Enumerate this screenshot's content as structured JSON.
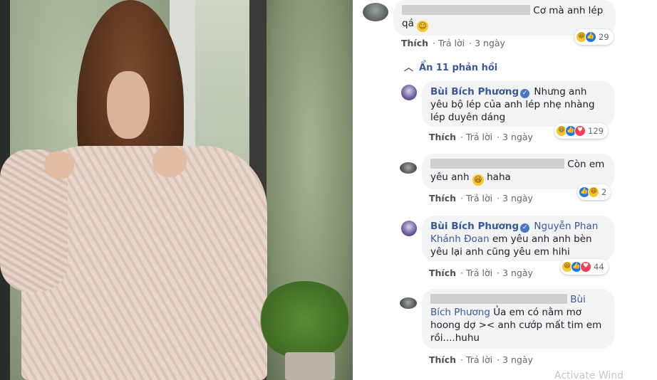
{
  "photo": {
    "alt": "woman in knit sweater by window"
  },
  "comments": [
    {
      "id": "c1",
      "redacted_name": true,
      "text": "Cơ mà anh lép qá",
      "emoji": "☺",
      "actions": {
        "like": "Thích",
        "reply": "Trả lời",
        "time": "3 ngày"
      },
      "reactions": [
        "haha",
        "like"
      ],
      "reaction_count": "29"
    }
  ],
  "toggle": {
    "label": "Ẩn 11 phản hồi"
  },
  "replies": [
    {
      "id": "r1",
      "name": "Bùi Bích Phương",
      "verified": true,
      "text": "Nhưng anh yêu bộ lép của anh lép nhẹ nhàng lép duyên dáng",
      "actions": {
        "like": "Thích",
        "reply": "Trả lời",
        "time": "3 ngày"
      },
      "reactions": [
        "haha",
        "like",
        "love"
      ],
      "reaction_count": "129"
    },
    {
      "id": "r2",
      "redacted_name": true,
      "text": "Còn em yêu anh",
      "text_after": "haha",
      "actions": {
        "like": "Thích",
        "reply": "Trả lời",
        "time": "3 ngày"
      },
      "reactions": [
        "like",
        "haha"
      ],
      "reaction_count": "2"
    },
    {
      "id": "r3",
      "name": "Bùi Bích Phương",
      "verified": true,
      "mention": "Nguyễn Phan Khánh Đoan",
      "text": "em yêu anh anh bèn yêu lại anh cũng yêu em hihi",
      "actions": {
        "like": "Thích",
        "reply": "Trả lời",
        "time": "3 ngày"
      },
      "reactions": [
        "haha",
        "like",
        "love"
      ],
      "reaction_count": "44"
    },
    {
      "id": "r4",
      "redacted_name": true,
      "mention": "Bùi Bích Phương",
      "text": "Ủa em có nằm mơ hoong dợ >< anh cướp mất tim em rồi....huhu",
      "actions": {
        "like": "Thích",
        "reply": "Trả lời",
        "time": "3 ngày"
      }
    }
  ],
  "watermark": "Activate Wind"
}
